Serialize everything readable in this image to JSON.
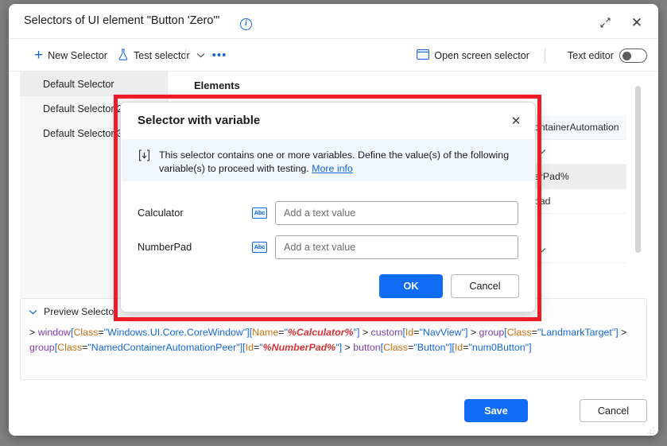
{
  "window": {
    "title": "Selectors of UI element \"Button 'Zero'\"",
    "info_icon": "info-circle-icon",
    "expand_icon": "expand-icon",
    "close_icon": "close-icon"
  },
  "toolbar": {
    "new_selector": "New Selector",
    "test_selector": "Test selector",
    "chevron_icon": "chevron-down-icon",
    "more_icon": "ellipsis-icon",
    "open_screen_selector": "Open screen selector",
    "screen_icon": "screen-selector-icon",
    "text_editor_label": "Text editor",
    "text_editor_on": false
  },
  "sidebar": {
    "items": [
      {
        "label": "Default Selector",
        "active": true
      },
      {
        "label": "Default Selector 2",
        "active": false
      },
      {
        "label": "Default Selector 3",
        "active": false
      }
    ]
  },
  "elements": {
    "title": "Elements",
    "rows": [
      {
        "text": "ontainerAutomation",
        "style": "tint"
      },
      {
        "text": "",
        "style": "chev"
      },
      {
        "text": "erPad%",
        "style": "shaded"
      },
      {
        "text": "pad",
        "style": "plain"
      },
      {
        "text": "",
        "style": "chev"
      }
    ],
    "scrollbar": "vertical-scrollbar"
  },
  "preview": {
    "header": "Preview Selector",
    "chevron_icon": "chevron-down-icon",
    "selector_tokens": [
      {
        "t": "> ",
        "c": "plain"
      },
      {
        "t": "window",
        "c": "tag"
      },
      {
        "t": "[",
        "c": "brk"
      },
      {
        "t": "Class",
        "c": "attr"
      },
      {
        "t": "=",
        "c": "plain"
      },
      {
        "t": "\"Windows.UI.Core.CoreWindow\"",
        "c": "str"
      },
      {
        "t": "]",
        "c": "brk"
      },
      {
        "t": "[",
        "c": "brk"
      },
      {
        "t": "Name",
        "c": "attr"
      },
      {
        "t": "=",
        "c": "plain"
      },
      {
        "t": "\"",
        "c": "str"
      },
      {
        "t": "%Calculator%",
        "c": "var"
      },
      {
        "t": "\"",
        "c": "str"
      },
      {
        "t": "]",
        "c": "brk"
      },
      {
        "t": " > ",
        "c": "plain"
      },
      {
        "t": "custom",
        "c": "tag"
      },
      {
        "t": "[",
        "c": "brk"
      },
      {
        "t": "Id",
        "c": "attr"
      },
      {
        "t": "=",
        "c": "plain"
      },
      {
        "t": "\"NavView\"",
        "c": "str"
      },
      {
        "t": "]",
        "c": "brk"
      },
      {
        "t": " > ",
        "c": "plain"
      },
      {
        "t": "group",
        "c": "tag"
      },
      {
        "t": "[",
        "c": "brk"
      },
      {
        "t": "Class",
        "c": "attr"
      },
      {
        "t": "=",
        "c": "plain"
      },
      {
        "t": "\"LandmarkTarget\"",
        "c": "str"
      },
      {
        "t": "]",
        "c": "brk"
      },
      {
        "t": " > ",
        "c": "plain"
      },
      {
        "t": "group",
        "c": "tag"
      },
      {
        "t": "[",
        "c": "brk"
      },
      {
        "t": "Class",
        "c": "attr"
      },
      {
        "t": "=",
        "c": "plain"
      },
      {
        "t": "\"NamedContainerAutomationPeer\"",
        "c": "str"
      },
      {
        "t": "]",
        "c": "brk"
      },
      {
        "t": "[",
        "c": "brk"
      },
      {
        "t": "Id",
        "c": "attr"
      },
      {
        "t": "=",
        "c": "plain"
      },
      {
        "t": "\"",
        "c": "str"
      },
      {
        "t": "%NumberPad%",
        "c": "var"
      },
      {
        "t": "\"",
        "c": "str"
      },
      {
        "t": "]",
        "c": "brk"
      },
      {
        "t": " > ",
        "c": "plain"
      },
      {
        "t": "button",
        "c": "tag"
      },
      {
        "t": "[",
        "c": "brk"
      },
      {
        "t": "Class",
        "c": "attr"
      },
      {
        "t": "=",
        "c": "plain"
      },
      {
        "t": "\"Button\"",
        "c": "str"
      },
      {
        "t": "]",
        "c": "brk"
      },
      {
        "t": "[",
        "c": "brk"
      },
      {
        "t": "Id",
        "c": "attr"
      },
      {
        "t": "=",
        "c": "plain"
      },
      {
        "t": "\"num0Button\"",
        "c": "str"
      },
      {
        "t": "]",
        "c": "brk"
      }
    ]
  },
  "footer": {
    "save": "Save",
    "cancel": "Cancel",
    "resize_grip": "resize-grip-icon"
  },
  "dialog": {
    "title": "Selector with variable",
    "close_icon": "close-icon",
    "banner": {
      "icon": "variable-input-icon",
      "text": "This selector contains one or more variables. Define the value(s) of the following variable(s) to proceed with testing. ",
      "link": "More info"
    },
    "fields": [
      {
        "label": "Calculator",
        "icon": "abc-text-icon",
        "icon_text": "Abc",
        "value": "",
        "placeholder": "Add a text value"
      },
      {
        "label": "NumberPad",
        "icon": "abc-text-icon",
        "icon_text": "Abc",
        "value": "",
        "placeholder": "Add a text value"
      }
    ],
    "ok": "OK",
    "cancel": "Cancel"
  },
  "colors": {
    "accent": "#0f6cf5",
    "link": "#1567d3",
    "annotation": "#ee1c25",
    "variable": "#d13438"
  }
}
